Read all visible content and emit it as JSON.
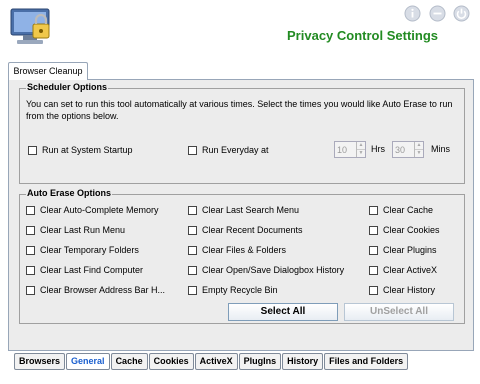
{
  "header": {
    "title": "Privacy Control Settings",
    "icons": [
      "info-icon",
      "minimize-icon",
      "power-icon"
    ]
  },
  "top_tab": {
    "label": "Browser Cleanup"
  },
  "scheduler": {
    "title": "Scheduler Options",
    "description": "You can set to run this tool automatically at various times. Select the times you would like Auto Erase to run from the options below.",
    "run_at_startup": {
      "label": "Run at System Startup",
      "checked": false
    },
    "run_everyday": {
      "label": "Run Everyday at",
      "checked": false
    },
    "hours_value": "10",
    "hours_label": "Hrs",
    "mins_value": "30",
    "mins_label": "Mins"
  },
  "auto_erase": {
    "title": "Auto Erase Options",
    "col1": [
      "Clear Auto-Complete Memory",
      "Clear Last Run Menu",
      "Clear Temporary Folders",
      "Clear Last Find Computer",
      "Clear Browser Address Bar H..."
    ],
    "col2": [
      "Clear Last Search Menu",
      "Clear Recent Documents",
      "Clear Files & Folders",
      "Clear Open/Save Dialogbox History",
      "Empty Recycle Bin"
    ],
    "col3": [
      "Clear Cache",
      "Clear Cookies",
      "Clear Plugins",
      "Clear ActiveX",
      "Clear History"
    ],
    "select_all": "Select All",
    "unselect_all": "UnSelect All"
  },
  "bottom_tabs": [
    "Browsers",
    "General",
    "Cache",
    "Cookies",
    "ActiveX",
    "PlugIns",
    "History",
    "Files and Folders"
  ],
  "active_tab": "General",
  "colors": {
    "title": "#228b22",
    "active_tab": "#1a5fcf"
  }
}
